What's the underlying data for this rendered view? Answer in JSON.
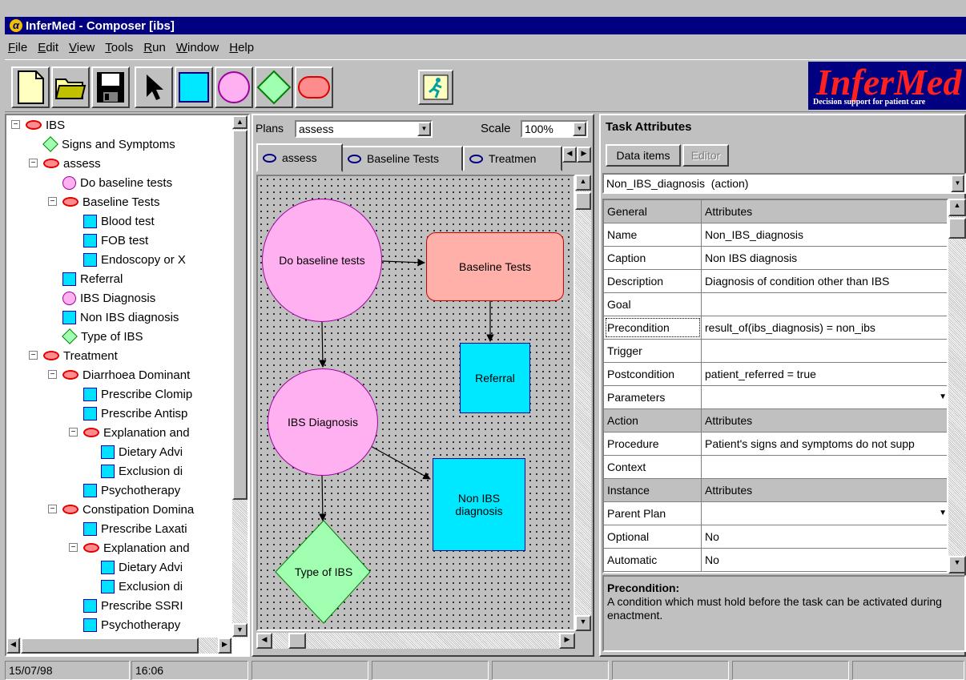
{
  "window": {
    "title": "InferMed - Composer [ibs]"
  },
  "menu": [
    "File",
    "Edit",
    "View",
    "Tools",
    "Run",
    "Window",
    "Help"
  ],
  "toolbar": {
    "buttons": [
      "new-file",
      "open-folder",
      "save-disk",
      "pointer-arrow",
      "square-shape",
      "circle-shape",
      "diamond-shape",
      "rounded-rect-shape",
      "run-enactment"
    ]
  },
  "brand": {
    "name": "InferMed",
    "tagline": "Decision support for patient care"
  },
  "tree": {
    "items": [
      {
        "label": "IBS",
        "icon": "ellipse-icon",
        "depth": 0,
        "expander": "−"
      },
      {
        "label": "Signs and Symptoms",
        "icon": "diamond-icon",
        "depth": 1
      },
      {
        "label": "assess",
        "icon": "ellipse-icon",
        "depth": 1,
        "expander": "−"
      },
      {
        "label": "Do baseline tests",
        "icon": "circle-icon",
        "depth": 2
      },
      {
        "label": "Baseline Tests",
        "icon": "ellipse-icon",
        "depth": 2,
        "expander": "−"
      },
      {
        "label": "Blood test",
        "icon": "square-icon",
        "depth": 3
      },
      {
        "label": "FOB test",
        "icon": "square-icon",
        "depth": 3
      },
      {
        "label": "Endoscopy or X",
        "icon": "square-icon",
        "depth": 3
      },
      {
        "label": "Referral",
        "icon": "square-icon",
        "depth": 2
      },
      {
        "label": "IBS Diagnosis",
        "icon": "circle-icon",
        "depth": 2
      },
      {
        "label": "Non IBS diagnosis",
        "icon": "square-icon",
        "depth": 2
      },
      {
        "label": "Type of IBS",
        "icon": "diamond-icon",
        "depth": 2
      },
      {
        "label": "Treatment",
        "icon": "ellipse-icon",
        "depth": 1,
        "expander": "−"
      },
      {
        "label": "Diarrhoea Dominant",
        "icon": "ellipse-icon",
        "depth": 2,
        "expander": "−"
      },
      {
        "label": "Prescribe Clomip",
        "icon": "square-icon",
        "depth": 3
      },
      {
        "label": "Prescribe Antisp",
        "icon": "square-icon",
        "depth": 3
      },
      {
        "label": "Explanation and",
        "icon": "ellipse-icon",
        "depth": 3,
        "expander": "−"
      },
      {
        "label": "Dietary Advi",
        "icon": "square-icon",
        "depth": 4
      },
      {
        "label": "Exclusion di",
        "icon": "square-icon",
        "depth": 4
      },
      {
        "label": "Psychotherapy",
        "icon": "square-icon",
        "depth": 3
      },
      {
        "label": "Constipation Domina",
        "icon": "ellipse-icon",
        "depth": 2,
        "expander": "−"
      },
      {
        "label": "Prescribe Laxati",
        "icon": "square-icon",
        "depth": 3
      },
      {
        "label": "Explanation and",
        "icon": "ellipse-icon",
        "depth": 3,
        "expander": "−"
      },
      {
        "label": "Dietary Advi",
        "icon": "square-icon",
        "depth": 4
      },
      {
        "label": "Exclusion di",
        "icon": "square-icon",
        "depth": 4
      },
      {
        "label": "Prescribe SSRI",
        "icon": "square-icon",
        "depth": 3
      },
      {
        "label": "Psychotherapy",
        "icon": "square-icon",
        "depth": 3
      }
    ]
  },
  "plans": {
    "label": "Plans",
    "value": "assess",
    "scale_label": "Scale",
    "scale_value": "100%"
  },
  "tabs": [
    "assess",
    "Baseline Tests",
    "Treatmen"
  ],
  "diagram": {
    "nodes": [
      {
        "id": "do-baseline-tests",
        "label": "Do baseline tests",
        "shape": "circle"
      },
      {
        "id": "baseline-tests",
        "label": "Baseline Tests",
        "shape": "rounded-rect"
      },
      {
        "id": "referral",
        "label": "Referral",
        "shape": "square"
      },
      {
        "id": "ibs-diagnosis",
        "label": "IBS Diagnosis",
        "shape": "circle"
      },
      {
        "id": "non-ibs-diagnosis",
        "label": "Non IBS diagnosis",
        "shape": "square"
      },
      {
        "id": "type-of-ibs",
        "label": "Type of IBS",
        "shape": "diamond"
      }
    ],
    "edges": [
      [
        "do-baseline-tests",
        "baseline-tests"
      ],
      [
        "baseline-tests",
        "referral"
      ],
      [
        "do-baseline-tests",
        "ibs-diagnosis"
      ],
      [
        "ibs-diagnosis",
        "non-ibs-diagnosis"
      ],
      [
        "ibs-diagnosis",
        "type-of-ibs"
      ]
    ]
  },
  "task_panel": {
    "title": "Task Attributes",
    "data_items_button": "Data items",
    "editor_button": "Editor",
    "selected_task": "Non_IBS_diagnosis  (action)",
    "rows": [
      {
        "key": "General",
        "value": "Attributes",
        "header": true
      },
      {
        "key": "Name",
        "value": "Non_IBS_diagnosis"
      },
      {
        "key": "Caption",
        "value": "Non IBS diagnosis"
      },
      {
        "key": "Description",
        "value": "Diagnosis of condition other than IBS"
      },
      {
        "key": "Goal",
        "value": ""
      },
      {
        "key": "Precondition",
        "value": "result_of(ibs_diagnosis) = non_ibs",
        "selected": true
      },
      {
        "key": "Trigger",
        "value": ""
      },
      {
        "key": "Postcondition",
        "value": "patient_referred = true"
      },
      {
        "key": "Parameters",
        "value": "",
        "dropdown": true
      },
      {
        "key": "Action",
        "value": "Attributes",
        "header": true
      },
      {
        "key": "Procedure",
        "value": "Patient's signs and symptoms do not supp"
      },
      {
        "key": "Context",
        "value": ""
      },
      {
        "key": "Instance",
        "value": "Attributes",
        "header": true
      },
      {
        "key": "Parent Plan",
        "value": "",
        "dropdown": true
      },
      {
        "key": "Optional",
        "value": "No"
      },
      {
        "key": "Automatic",
        "value": "No"
      }
    ],
    "help_title": "Precondition:",
    "help_text": "A condition which must hold before the task can be activated during enactment."
  },
  "status": {
    "date": "15/07/98",
    "time": "16:06"
  }
}
